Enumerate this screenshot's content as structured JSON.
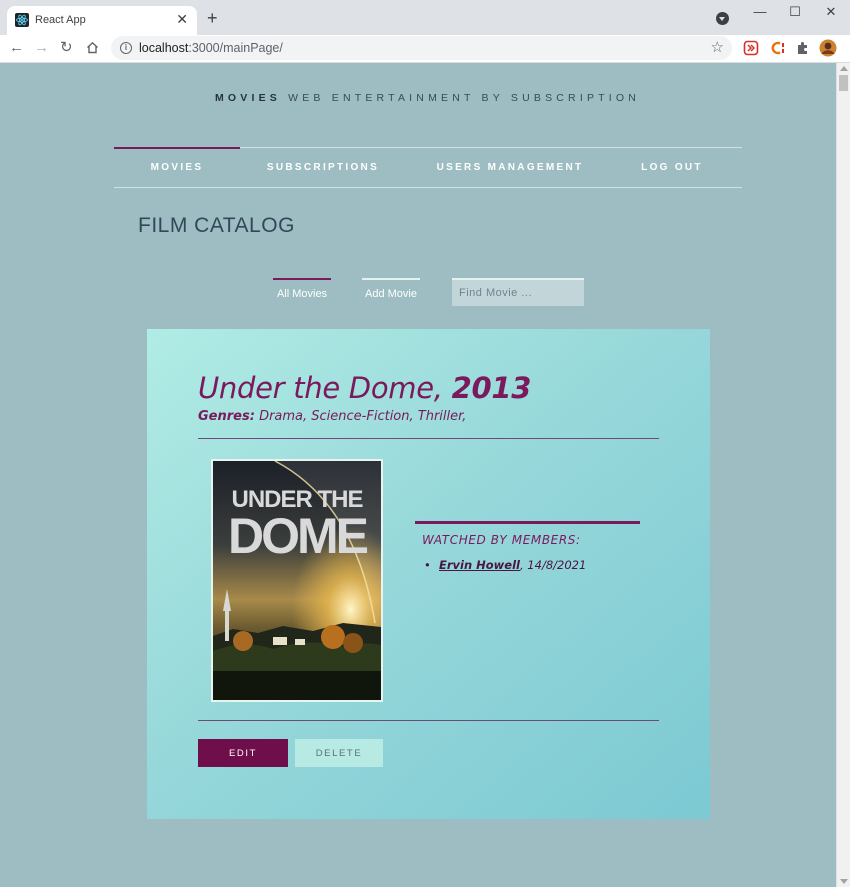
{
  "browser": {
    "tab_title": "React App",
    "tab_close": "✕",
    "new_tab": "+",
    "url_host": "localhost",
    "url_path": ":3000/mainPage/",
    "window_minimize": "—",
    "window_maximize": "☐",
    "window_close": "✕"
  },
  "brand": {
    "strong": "MOVIES",
    "rest": "WEB ENTERTAINMENT BY SUBSCRIPTION"
  },
  "nav": {
    "items": [
      {
        "label": "MOVIES",
        "active": true
      },
      {
        "label": "SUBSCRIPTIONS",
        "active": false
      },
      {
        "label": "USERS MANAGEMENT",
        "active": false
      },
      {
        "label": "LOG OUT",
        "active": false
      }
    ]
  },
  "page": {
    "title": "FILM CATALOG"
  },
  "subnav": {
    "all_movies": "All Movies",
    "add_movie": "Add Movie",
    "search_placeholder": "Find Movie ..."
  },
  "movie": {
    "name": "Under the Dome,",
    "year": "2013",
    "genres_label": "Genres:",
    "genres": "Drama, Science-Fiction, Thriller,",
    "poster_line1": "UNDER THE",
    "poster_line2": "DOME",
    "watched_title": "WATCHED BY MEMBERS:",
    "members": [
      {
        "name": "Ervin Howell",
        "date": ", 14/8/2021"
      }
    ]
  },
  "actions": {
    "edit": "EDIT",
    "delete": "DELETE"
  },
  "colors": {
    "accent": "#7a1a5c",
    "page_bg": "#9dbdc2",
    "edit_button": "#6e0f4b"
  }
}
